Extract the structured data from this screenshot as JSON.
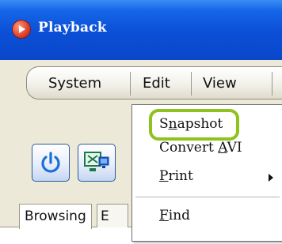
{
  "window": {
    "title": "Playback",
    "icon": "playback-app-icon"
  },
  "menubar": {
    "items": [
      {
        "label": "System"
      },
      {
        "label": "Edit"
      },
      {
        "label": "View"
      }
    ]
  },
  "toolbar": {
    "buttons": [
      {
        "icon": "power-icon"
      },
      {
        "icon": "monitor-grid-icon"
      }
    ]
  },
  "tabs": [
    {
      "label": "Browsing",
      "active": true
    },
    {
      "label": "E",
      "active": false
    }
  ],
  "edit_menu": {
    "items": [
      {
        "pre": "S",
        "accel": "n",
        "post": "apshot",
        "highlighted": true
      },
      {
        "pre": "Convert ",
        "accel": "A",
        "post": "VI"
      },
      {
        "pre": "",
        "accel": "P",
        "post": "rint",
        "submenu": true
      },
      {
        "pre": "",
        "accel": "F",
        "post": "ind"
      }
    ]
  },
  "colors": {
    "title_bar": "#0b4fd6",
    "highlight_ring": "#8dc21f",
    "window_bg": "#ece9d8"
  }
}
